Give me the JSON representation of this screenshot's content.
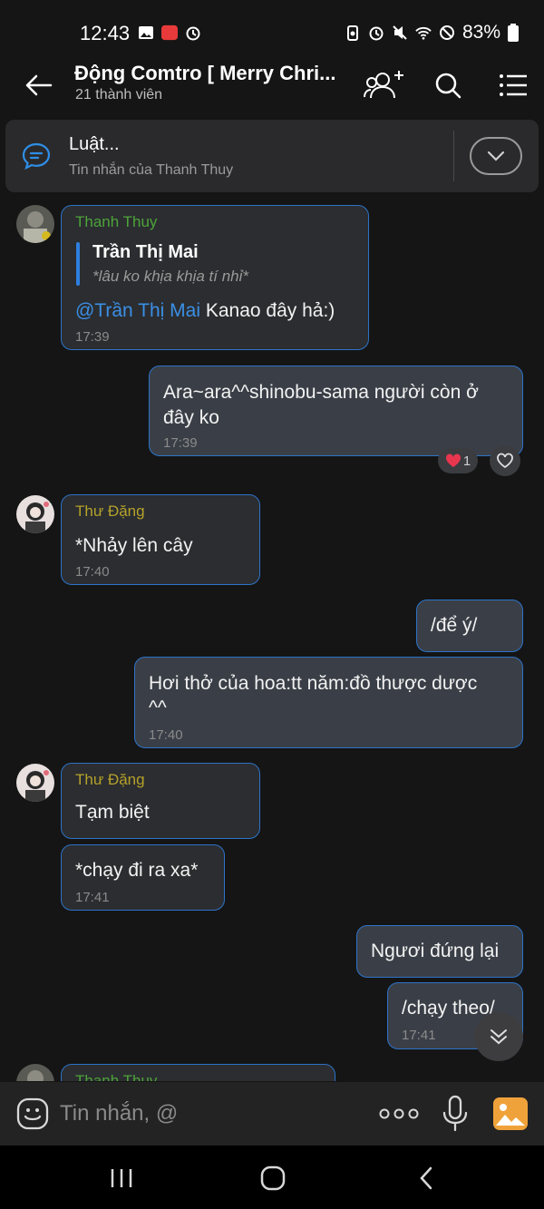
{
  "status_bar": {
    "time": "12:43",
    "battery": "83%"
  },
  "header": {
    "title": "Động Comtro [ Merry Chri...",
    "subtitle": "21 thành viên"
  },
  "pinned": {
    "title": "Luật...",
    "subtitle": "Tin nhắn của Thanh Thuy"
  },
  "messages": [
    {
      "sender": "Thanh Thuy",
      "quote_name": "Trần Thị Mai",
      "quote_text": "*lâu ko khịa khịa tí nhỉ*",
      "mention": "@Trần Thị Mai",
      "text": " Kanao đây hả:)",
      "time": "17:39"
    },
    {
      "text_line1": "Ara~ara^^shinobu-sama người còn ở",
      "text_line2": "đây ko",
      "time": "17:39",
      "reaction_count": "1"
    },
    {
      "sender": "Thư Đặng",
      "text": "*Nhảy lên cây",
      "time": "17:40"
    },
    {
      "text": "/để ý/"
    },
    {
      "text_line1": "Hơi thở của hoa:tt năm:đồ thược dược",
      "text_line2": "^^",
      "time": "17:40"
    },
    {
      "sender": "Thư Đặng",
      "text": "Tạm biệt"
    },
    {
      "text": "*chạy đi ra xa*",
      "time": "17:41"
    },
    {
      "text": "Ngươi đứng lại"
    },
    {
      "text": "/chạy theo/",
      "time": "17:41"
    },
    {
      "sender": "Thanh Thuy"
    }
  ],
  "input": {
    "placeholder": "Tin nhắn, @"
  },
  "icons": {
    "back": "arrow-left-icon",
    "add_member": "add-member-icon",
    "search": "search-icon",
    "menu": "menu-icon",
    "pin": "chat-bubble-icon",
    "expand": "chevron-down-icon",
    "emoji": "emoji-icon",
    "more": "more-icon",
    "mic": "microphone-icon",
    "photo": "photo-icon",
    "heart": "heart-icon",
    "scroll_down": "double-chevron-down-icon"
  },
  "colors": {
    "accent": "#2d73c8",
    "mention": "#3b8fe6",
    "sender_green": "#4da33a",
    "sender_olive": "#b5a22a",
    "background": "#151515"
  }
}
